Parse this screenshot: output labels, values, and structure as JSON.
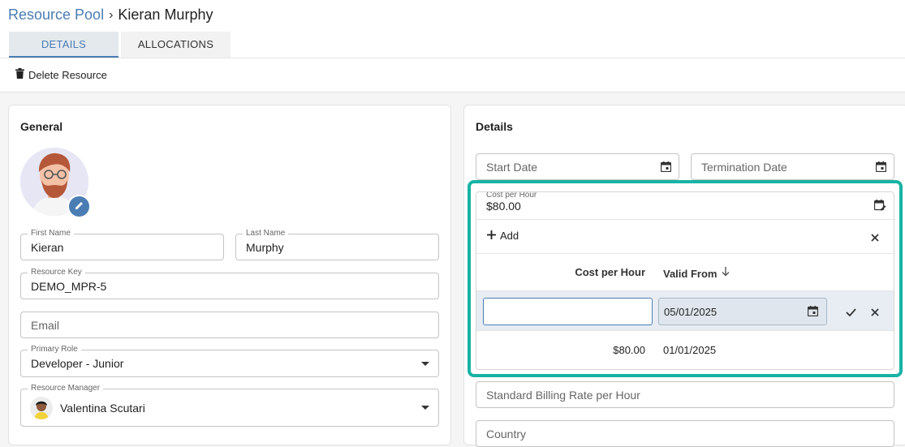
{
  "breadcrumb": {
    "parent": "Resource Pool",
    "separator": "›",
    "current": "Kieran Murphy"
  },
  "tabs": [
    {
      "label": "DETAILS",
      "active": true
    },
    {
      "label": "ALLOCATIONS",
      "active": false
    }
  ],
  "toolbar": {
    "delete_label": "Delete Resource",
    "delete_icon": "trash-icon"
  },
  "general": {
    "title": "General",
    "first_name": {
      "label": "First Name",
      "value": "Kieran"
    },
    "last_name": {
      "label": "Last Name",
      "value": "Murphy"
    },
    "resource_key": {
      "label": "Resource Key",
      "value": "DEMO_MPR-5"
    },
    "email": {
      "placeholder": "Email"
    },
    "primary_role": {
      "label": "Primary Role",
      "value": "Developer - Junior"
    },
    "resource_manager": {
      "label": "Resource Manager",
      "value": "Valentina Scutari"
    }
  },
  "details": {
    "title": "Details",
    "start_date": {
      "placeholder": "Start Date"
    },
    "termination_date": {
      "placeholder": "Termination Date"
    },
    "cost_per_hour": {
      "label": "Cost per Hour",
      "value": "$80.00"
    },
    "popup": {
      "add_label": "Add",
      "col_cost": "Cost per Hour",
      "col_valid_from": "Valid From",
      "edit_row": {
        "cost": "",
        "valid_from": "05/01/2025"
      },
      "rows": [
        {
          "cost": "$80.00",
          "valid_from": "01/01/2025"
        }
      ]
    },
    "billing_rate": {
      "placeholder": "Standard Billing Rate per Hour"
    },
    "country": {
      "placeholder": "Country"
    }
  },
  "colors": {
    "accent": "#4a7db3",
    "highlight": "#17b3a3"
  }
}
